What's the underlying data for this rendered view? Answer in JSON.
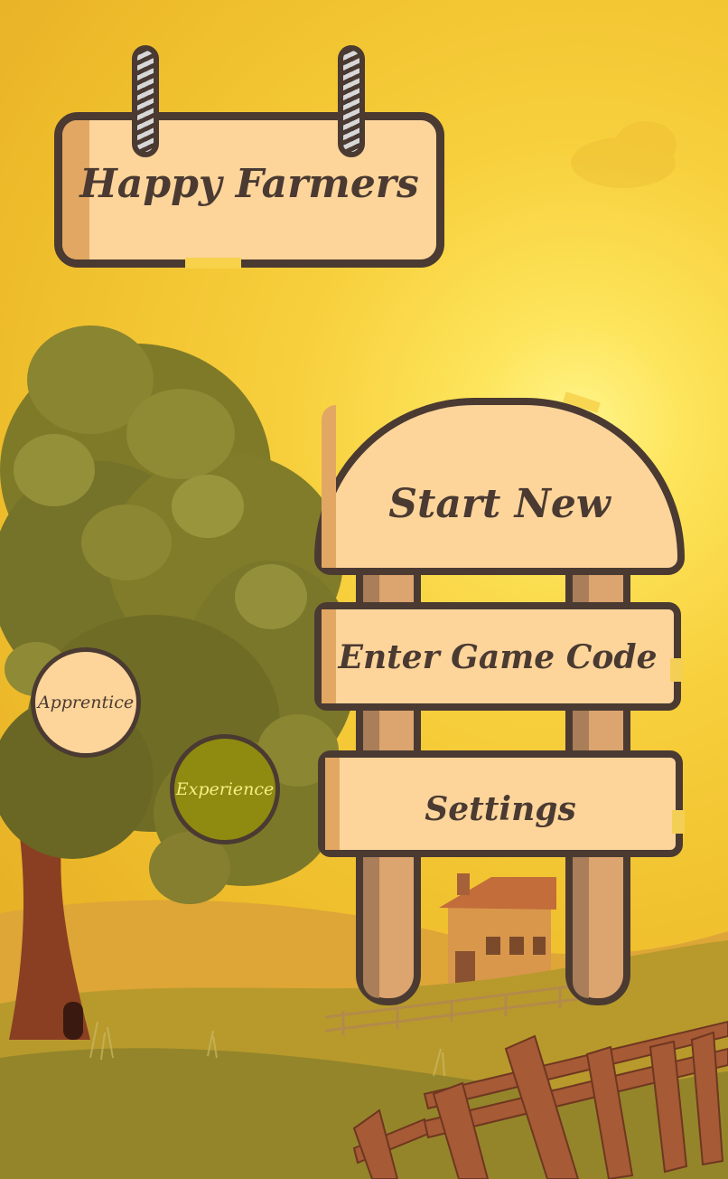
{
  "game": {
    "title": "Happy Farmers",
    "menu": {
      "start_new": "Start New",
      "enter_game_code": "Enter Game Code",
      "settings": "Settings"
    },
    "levels": {
      "apprentice": "Apprentice",
      "experience": "Experience"
    }
  },
  "colors": {
    "sky_light": "#fff58a",
    "sky": "#f7cf3c",
    "wood_light": "#fdd59a",
    "wood_shade": "#e3a764",
    "outline": "#4a3a32",
    "experience_fill": "#8f8a10"
  }
}
